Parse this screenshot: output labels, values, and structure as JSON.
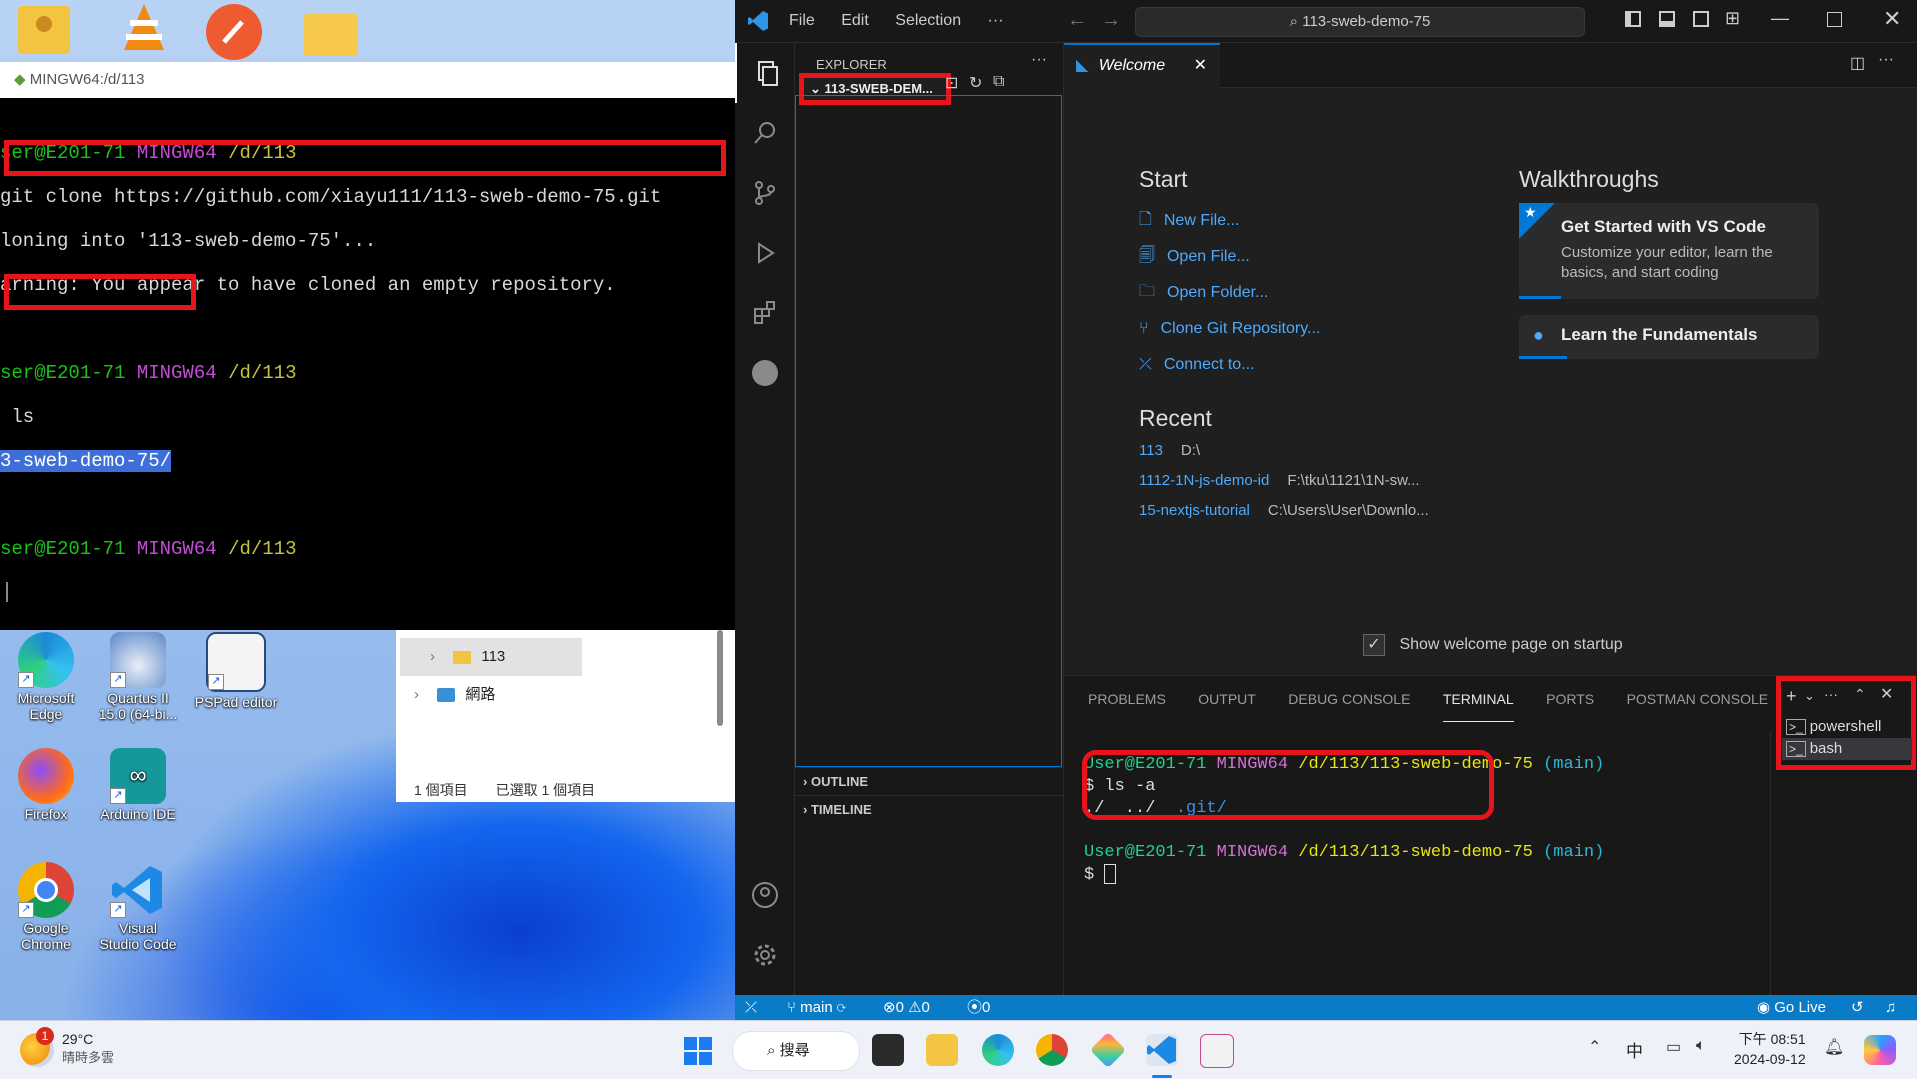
{
  "desktop": {
    "icons": [
      {
        "label_1": "Microsoft",
        "label_2": "Edge"
      },
      {
        "label_1": "Quartus II",
        "label_2": "15.0 (64-bi..."
      },
      {
        "label_1": "PSPad editor",
        "label_2": ""
      },
      {
        "label_1": "Firefox",
        "label_2": ""
      },
      {
        "label_1": "Arduino IDE",
        "label_2": ""
      },
      {
        "label_1": "Google",
        "label_2": "Chrome"
      },
      {
        "label_1": "Visual",
        "label_2": "Studio Code"
      }
    ]
  },
  "gitbash": {
    "title": "MINGW64:/d/113",
    "prompt_user": "ser@E201-71",
    "prompt_host": "MINGW64",
    "prompt_path": "/d/113",
    "cmd_clone": "git clone https://github.com/xiayu111/113-sweb-demo-75.git",
    "out_cloning": "loning into '113-sweb-demo-75'...",
    "out_warning": "arning: You appear to have cloned an empty repository.",
    "cmd_ls": "ls",
    "out_ls": "3-sweb-demo-75/",
    "prompt_char": "$"
  },
  "file_explorer": {
    "tree_folder": "113",
    "tree_network": "網路",
    "status_count": "1 個項目",
    "status_selected": "已選取 1 個項目"
  },
  "vscode": {
    "menu": [
      "File",
      "Edit",
      "Selection",
      "···"
    ],
    "search": "113-sweb-demo-75",
    "explorer_title": "EXPLORER",
    "explorer_folder": "113-SWEB-DEM...",
    "outline": "OUTLINE",
    "timeline": "TIMELINE",
    "tab_welcome": "Welcome",
    "start_heading": "Start",
    "start_links": [
      "New File...",
      "Open File...",
      "Open Folder...",
      "Clone Git Repository...",
      "Connect to..."
    ],
    "recent_heading": "Recent",
    "recent": [
      {
        "name": "113",
        "path": "D:\\"
      },
      {
        "name": "1112-1N-js-demo-id",
        "path": "F:\\tku\\1121\\1N-sw..."
      },
      {
        "name": "15-nextjs-tutorial",
        "path": "C:\\Users\\User\\Downlo..."
      }
    ],
    "walkthroughs_heading": "Walkthroughs",
    "wt1_title": "Get Started with VS Code",
    "wt1_desc_1": "Customize your editor, learn the",
    "wt1_desc_2": "basics, and start coding",
    "wt2_title": "Learn the Fundamentals",
    "show_welcome": "Show welcome page on startup",
    "panel_tabs": [
      "PROBLEMS",
      "OUTPUT",
      "DEBUG CONSOLE",
      "TERMINAL",
      "PORTS",
      "POSTMAN CONSOLE"
    ],
    "terminal": {
      "user": "User@E201-71",
      "host": "MINGW64",
      "path": "/d/113/113-sweb-demo-75",
      "branch": "(main)",
      "cmd": "$ ls -a",
      "out_a": "./  ../  ",
      "out_b": ".git/",
      "prompt": "$ "
    },
    "terminal_list": [
      "powershell",
      "bash"
    ],
    "status": {
      "branch": "main",
      "errors": "0",
      "warnings": "0",
      "ports": "0",
      "golive": "Go Live"
    }
  },
  "taskbar": {
    "weather_temp": "29°C",
    "weather_desc": "晴時多雲",
    "weather_badge": "1",
    "search": "搜尋",
    "ime": "中",
    "time": "下午 08:51",
    "date": "2024-09-12"
  },
  "colors": {
    "accent": "#0078d4",
    "highlight_red": "#e8141c",
    "statusbar": "#0a7bc6"
  }
}
